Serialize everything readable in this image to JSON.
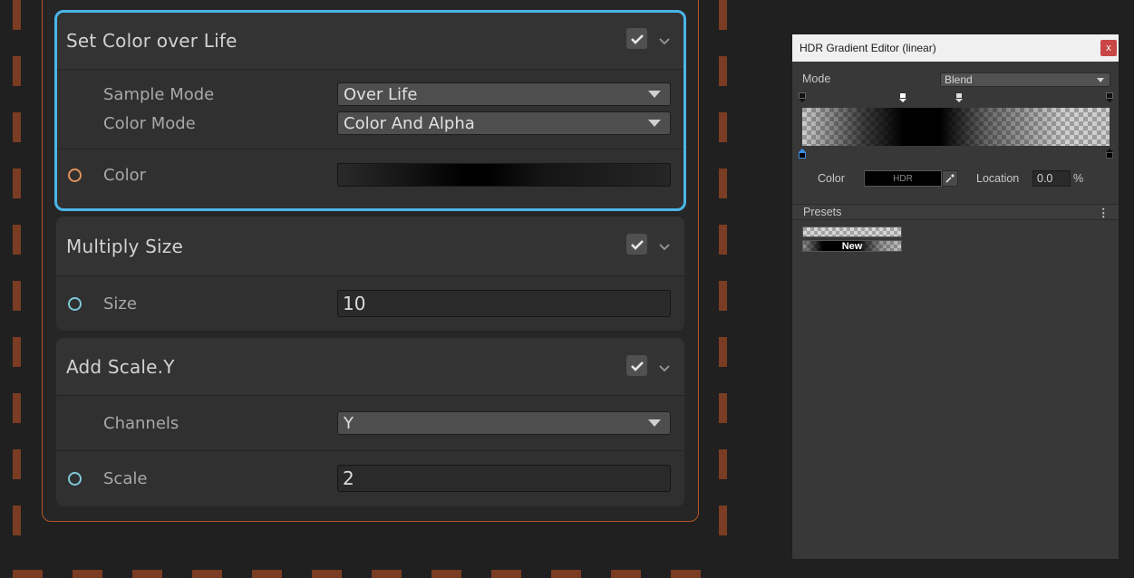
{
  "colors": {
    "selected_outline": "#4ab6e8",
    "context_border": "#b4542a",
    "dashed_border": "#7a3c22",
    "slot_float": "#7ec7d8",
    "slot_color": "#e0925a"
  },
  "blocks": [
    {
      "title": "Set Color over Life",
      "enabled": true,
      "selected": true,
      "settings": [
        {
          "label": "Sample Mode",
          "value": "Over Life"
        },
        {
          "label": "Color Mode",
          "value": "Color And Alpha"
        }
      ],
      "inputs": [
        {
          "label": "Color",
          "type": "gradient"
        }
      ]
    },
    {
      "title": "Multiply Size",
      "enabled": true,
      "inputs": [
        {
          "label": "Size",
          "value": "10"
        }
      ]
    },
    {
      "title": "Add Scale.Y",
      "enabled": true,
      "settings": [
        {
          "label": "Channels",
          "value": "Y"
        }
      ],
      "inputs": [
        {
          "label": "Scale",
          "value": "2"
        }
      ]
    }
  ],
  "gradient_editor": {
    "title": "HDR Gradient Editor (linear)",
    "close_label": "x",
    "mode_label": "Mode",
    "mode_value": "Blend",
    "color_label": "Color",
    "color_badge": "HDR",
    "location_label": "Location",
    "location_value": "0.0",
    "location_unit": "%",
    "presets_label": "Presets",
    "presets_menu": "⋮",
    "preset_new_label": "New"
  }
}
